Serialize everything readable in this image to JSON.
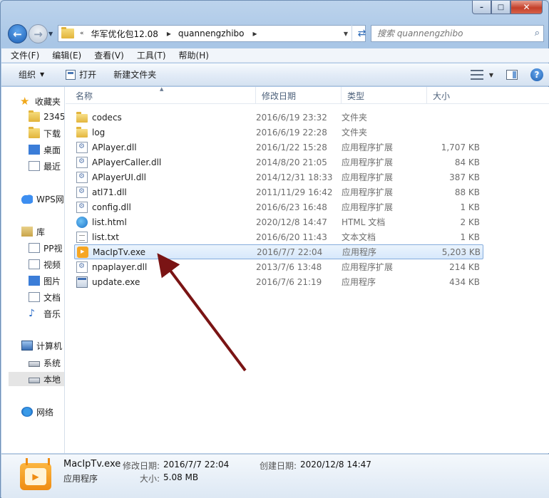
{
  "window": {
    "controls": {
      "minimize": "–",
      "maximize": "□",
      "close": "✕"
    }
  },
  "address": {
    "overflow": "«",
    "crumbs": [
      "华军优化包12.08",
      "quannengzhibo"
    ],
    "search_placeholder": "搜索 quannengzhibo"
  },
  "menu": [
    "文件(F)",
    "编辑(E)",
    "查看(V)",
    "工具(T)",
    "帮助(H)"
  ],
  "commands": {
    "organize": "组织",
    "open": "打开",
    "new_folder": "新建文件夹"
  },
  "nav": {
    "favorites": "收藏夹",
    "fav_items": [
      "2345",
      "下载",
      "桌面",
      "最近"
    ],
    "wps": "WPS网",
    "library": "库",
    "lib_items": [
      "PP视",
      "视频",
      "图片",
      "文档",
      "音乐"
    ],
    "computer": "计算机",
    "comp_items": [
      "系统",
      "本地"
    ],
    "network": "网络"
  },
  "columns": {
    "name": "名称",
    "date": "修改日期",
    "type": "类型",
    "size": "大小"
  },
  "files": [
    {
      "name": "codecs",
      "date": "2016/6/19 23:32",
      "type": "文件夹",
      "size": "",
      "icon": "folder-icon"
    },
    {
      "name": "log",
      "date": "2016/6/19 22:28",
      "type": "文件夹",
      "size": "",
      "icon": "folder-icon"
    },
    {
      "name": "APlayer.dll",
      "date": "2016/1/22 15:28",
      "type": "应用程序扩展",
      "size": "1,707 KB",
      "icon": "dll-icon"
    },
    {
      "name": "APlayerCaller.dll",
      "date": "2014/8/20 21:05",
      "type": "应用程序扩展",
      "size": "84 KB",
      "icon": "dll-icon"
    },
    {
      "name": "APlayerUI.dll",
      "date": "2014/12/31 18:33",
      "type": "应用程序扩展",
      "size": "387 KB",
      "icon": "dll-icon"
    },
    {
      "name": "atl71.dll",
      "date": "2011/11/29 16:42",
      "type": "应用程序扩展",
      "size": "88 KB",
      "icon": "dll-icon"
    },
    {
      "name": "config.dll",
      "date": "2016/6/23 16:48",
      "type": "应用程序扩展",
      "size": "1 KB",
      "icon": "dll-icon"
    },
    {
      "name": "list.html",
      "date": "2020/12/8 14:47",
      "type": "HTML 文档",
      "size": "2 KB",
      "icon": "html-icon"
    },
    {
      "name": "list.txt",
      "date": "2016/6/20 11:43",
      "type": "文本文档",
      "size": "1 KB",
      "icon": "txt-icon"
    },
    {
      "name": "MacIpTv.exe",
      "date": "2016/7/7 22:04",
      "type": "应用程序",
      "size": "5,203 KB",
      "icon": "tv-app-icon",
      "selected": true
    },
    {
      "name": "npaplayer.dll",
      "date": "2013/7/6 13:48",
      "type": "应用程序扩展",
      "size": "214 KB",
      "icon": "dll-icon"
    },
    {
      "name": "update.exe",
      "date": "2016/7/6 21:19",
      "type": "应用程序",
      "size": "434 KB",
      "icon": "exe-icon"
    }
  ],
  "details": {
    "name": "MacIpTv.exe",
    "type": "应用程序",
    "modified_label": "修改日期:",
    "modified": "2016/7/7 22:04",
    "created_label": "创建日期:",
    "created": "2020/12/8 14:47",
    "size_label": "大小:",
    "size": "5.08 MB"
  },
  "colors": {
    "arrow": "#7a1414",
    "selection": "#d7e8fb"
  }
}
